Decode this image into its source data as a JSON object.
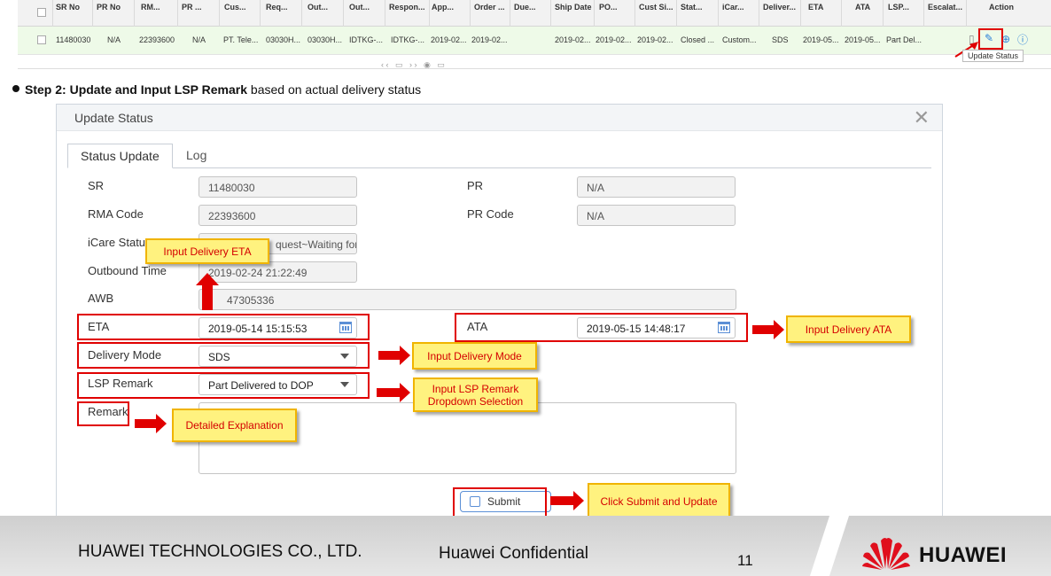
{
  "grid": {
    "columns": [
      {
        "label": "SR No"
      },
      {
        "label": "PR No"
      },
      {
        "label": "RM..."
      },
      {
        "label": "PR ..."
      },
      {
        "label": "Cus..."
      },
      {
        "label": "Req..."
      },
      {
        "label": "Out..."
      },
      {
        "label": "Out..."
      },
      {
        "label": "Respon..."
      },
      {
        "label": "App..."
      },
      {
        "label": "Order ..."
      },
      {
        "label": "Due..."
      },
      {
        "label": "Ship Date"
      },
      {
        "label": "PO..."
      },
      {
        "label": "Cust Si..."
      },
      {
        "label": "Stat..."
      },
      {
        "label": "iCar..."
      },
      {
        "label": "Deliver..."
      },
      {
        "label": "ETA"
      },
      {
        "label": "ATA"
      },
      {
        "label": "LSP..."
      },
      {
        "label": "Escalat..."
      },
      {
        "label": "Action"
      }
    ],
    "row": [
      "11480030",
      "N/A",
      "22393600",
      "N/A",
      "PT. Tele...",
      "03030H...",
      "03030H...",
      "IDTKG-...",
      "IDTKG-...",
      "2019-02...",
      "2019-02...",
      "",
      "2019-02...",
      "2019-02...",
      "2019-02...",
      "Closed ...",
      "Custom...",
      "SDS",
      "2019-05...",
      "2019-05...",
      "Part Del...",
      ""
    ],
    "tooltip": "Update Status"
  },
  "step": {
    "prefix": "Step 2: ",
    "bold": "Update and Input LSP Remark",
    "suffix": " based on actual delivery status"
  },
  "dialog": {
    "title": "Update Status",
    "close_glyph": "✕",
    "tabs": [
      "Status Update",
      "Log"
    ],
    "fields": {
      "sr": {
        "label": "SR",
        "value": "11480030"
      },
      "pr": {
        "label": "PR",
        "value": "N/A"
      },
      "rma": {
        "label": "RMA Code",
        "value": "22393600"
      },
      "pr_code": {
        "label": "PR Code",
        "value": "N/A"
      },
      "icare": {
        "label": "iCare Status",
        "value": "quest~Waiting for"
      },
      "outbound": {
        "label": "Outbound Time",
        "value": "2019-02-24 21:22:49"
      },
      "awb": {
        "label": "AWB",
        "value": "47305336"
      },
      "eta": {
        "label": "ETA",
        "value": "2019-05-14 15:15:53"
      },
      "ata": {
        "label": "ATA",
        "value": "2019-05-15 14:48:17"
      },
      "delivery_mode": {
        "label": "Delivery Mode",
        "value": "SDS"
      },
      "lsp_remark": {
        "label": "LSP Remark",
        "value": "Part Delivered to DOP"
      },
      "remark": {
        "label": "Remark",
        "value": ""
      }
    },
    "submit_label": "Submit"
  },
  "callouts": {
    "eta": "Input Delivery ETA",
    "ata": "Input Delivery ATA",
    "mode": "Input Delivery Mode",
    "lsp": "Input LSP Remark Dropdown Selection",
    "remark": "Detailed Explanation",
    "submit": "Click Submit and Update"
  },
  "footer": {
    "company": "HUAWEI TECHNOLOGIES CO., LTD.",
    "confidential": "Huawei Confidential",
    "page": "11",
    "brand": "HUAWEI"
  },
  "colors": {
    "annotation_red": "#e00000",
    "callout_fill": "#fff27f",
    "callout_border": "#f0b400",
    "row_highlight": "#eefae8",
    "accent_blue": "#2a7fd8"
  }
}
